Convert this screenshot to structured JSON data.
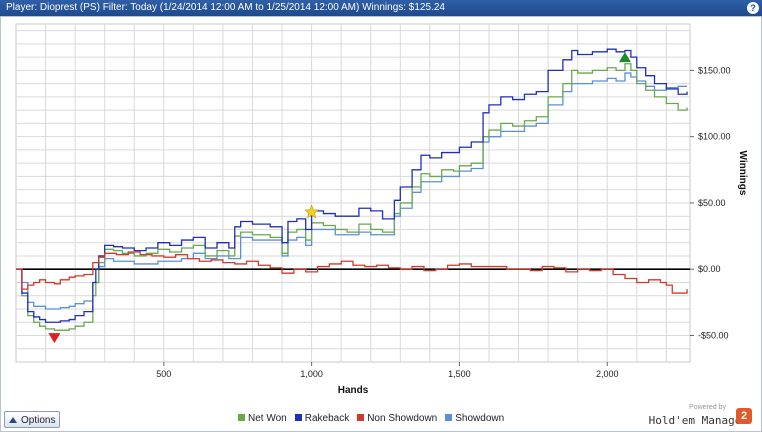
{
  "header": {
    "title": "Player: Dioprest (PS) Filter: Today (1/24/2014 12:00 AM to 1/25/2014 12:00 AM) Winnings: $125.24",
    "help_label": "?"
  },
  "controls": {
    "options_label": "Options"
  },
  "brand": {
    "powered_by": "Powered by",
    "name": "Hold'em Manager",
    "logo_text": "2"
  },
  "colors": {
    "net_won": "#6aa84f",
    "rakeback": "#1f2fb8",
    "non_showdown": "#d03a2a",
    "showdown": "#5b8fd8",
    "grid": "#d9d9d9",
    "zero_line": "#000000",
    "titlebar": "#1e4a8e"
  },
  "chart_data": {
    "type": "line",
    "xlabel": "Hands",
    "ylabel": "Winnings",
    "xlim": [
      0,
      2280
    ],
    "ylim": [
      -70,
      185
    ],
    "x_ticks": [
      500,
      1000,
      1500,
      2000
    ],
    "x_tick_labels": [
      "500",
      "1,000",
      "1,500",
      "2,000"
    ],
    "y_ticks": [
      -50,
      0,
      50,
      100,
      150
    ],
    "y_tick_labels": [
      "-$50.00",
      "$0.00",
      "$50.00",
      "$100.00",
      "$150.00"
    ],
    "grid": true,
    "legend_position": "bottom",
    "series": [
      {
        "name": "Net Won",
        "color": "#6aa84f",
        "x": [
          0,
          20,
          40,
          60,
          80,
          100,
          130,
          150,
          180,
          200,
          230,
          260,
          270,
          280,
          300,
          330,
          360,
          400,
          440,
          480,
          520,
          560,
          600,
          640,
          680,
          720,
          740,
          760,
          800,
          860,
          900,
          920,
          950,
          980,
          1000,
          1040,
          1080,
          1120,
          1160,
          1200,
          1240,
          1280,
          1300,
          1340,
          1370,
          1400,
          1440,
          1480,
          1500,
          1540,
          1580,
          1600,
          1640,
          1680,
          1720,
          1760,
          1800,
          1850,
          1880,
          1900,
          1950,
          2000,
          2030,
          2060,
          2080,
          2100,
          2130,
          2160,
          2200,
          2240,
          2270
        ],
        "values": [
          0,
          -20,
          -35,
          -40,
          -43,
          -45,
          -46,
          -46,
          -45,
          -43,
          -40,
          -20,
          -10,
          5,
          15,
          14,
          12,
          10,
          12,
          15,
          13,
          16,
          18,
          10,
          14,
          10,
          25,
          28,
          26,
          24,
          12,
          28,
          30,
          22,
          35,
          33,
          30,
          28,
          34,
          30,
          28,
          42,
          50,
          62,
          72,
          70,
          75,
          74,
          78,
          80,
          100,
          105,
          110,
          108,
          112,
          115,
          130,
          140,
          150,
          148,
          150,
          152,
          150,
          155,
          150,
          140,
          135,
          130,
          125,
          120,
          122
        ]
      },
      {
        "name": "Rakeback",
        "color": "#1f2fb8",
        "x": [
          0,
          20,
          40,
          60,
          80,
          100,
          130,
          150,
          180,
          200,
          230,
          260,
          270,
          280,
          300,
          330,
          360,
          400,
          440,
          480,
          520,
          560,
          600,
          640,
          680,
          720,
          740,
          760,
          800,
          860,
          900,
          920,
          950,
          980,
          1000,
          1040,
          1080,
          1120,
          1160,
          1200,
          1240,
          1280,
          1300,
          1340,
          1370,
          1400,
          1440,
          1480,
          1500,
          1540,
          1580,
          1600,
          1640,
          1680,
          1720,
          1760,
          1800,
          1850,
          1880,
          1900,
          1950,
          2000,
          2030,
          2060,
          2080,
          2100,
          2130,
          2160,
          2200,
          2240,
          2270
        ],
        "values": [
          0,
          -18,
          -32,
          -36,
          -38,
          -40,
          -40,
          -39,
          -38,
          -35,
          -32,
          -10,
          0,
          10,
          18,
          17,
          16,
          14,
          16,
          20,
          18,
          22,
          24,
          16,
          20,
          16,
          32,
          36,
          34,
          32,
          20,
          36,
          38,
          30,
          44,
          42,
          40,
          40,
          46,
          44,
          38,
          52,
          62,
          75,
          86,
          84,
          88,
          88,
          92,
          96,
          118,
          124,
          130,
          128,
          132,
          134,
          150,
          158,
          165,
          162,
          164,
          166,
          164,
          165,
          160,
          152,
          146,
          140,
          136,
          132,
          134
        ]
      },
      {
        "name": "Non Showdown",
        "color": "#d03a2a",
        "x": [
          0,
          20,
          40,
          60,
          80,
          100,
          130,
          150,
          180,
          200,
          230,
          260,
          280,
          300,
          340,
          380,
          420,
          460,
          500,
          540,
          580,
          620,
          660,
          700,
          740,
          780,
          820,
          860,
          900,
          940,
          980,
          1020,
          1060,
          1100,
          1140,
          1180,
          1220,
          1260,
          1300,
          1340,
          1380,
          1420,
          1460,
          1500,
          1540,
          1580,
          1620,
          1660,
          1700,
          1740,
          1780,
          1820,
          1860,
          1900,
          1940,
          1980,
          2020,
          2060,
          2100,
          2140,
          2180,
          2200,
          2220,
          2240,
          2270
        ],
        "values": [
          0,
          -15,
          -12,
          -10,
          -8,
          -10,
          -11,
          -8,
          -6,
          -5,
          -4,
          5,
          9,
          12,
          11,
          13,
          11,
          10,
          9,
          11,
          8,
          6,
          7,
          5,
          4,
          6,
          3,
          1,
          -3,
          0,
          -2,
          2,
          4,
          6,
          3,
          2,
          3,
          1,
          0,
          2,
          -1,
          0,
          3,
          4,
          2,
          2,
          2,
          0,
          0,
          -1,
          2,
          1,
          -2,
          0,
          -1,
          0,
          -4,
          -7,
          -10,
          -8,
          -10,
          -12,
          -18,
          -18,
          -15
        ]
      },
      {
        "name": "Showdown",
        "color": "#5b8fd8",
        "x": [
          0,
          20,
          40,
          60,
          80,
          100,
          130,
          150,
          180,
          200,
          230,
          260,
          280,
          300,
          330,
          360,
          400,
          440,
          480,
          520,
          560,
          600,
          640,
          680,
          720,
          760,
          800,
          860,
          900,
          920,
          950,
          980,
          1000,
          1040,
          1080,
          1120,
          1160,
          1200,
          1240,
          1280,
          1300,
          1340,
          1370,
          1400,
          1440,
          1480,
          1500,
          1540,
          1580,
          1600,
          1640,
          1680,
          1720,
          1760,
          1800,
          1850,
          1880,
          1900,
          1950,
          2000,
          2030,
          2060,
          2080,
          2100,
          2130,
          2160,
          2200,
          2240,
          2270
        ],
        "values": [
          0,
          -10,
          -25,
          -28,
          -28,
          -30,
          -30,
          -29,
          -28,
          -26,
          -24,
          -10,
          2,
          8,
          6,
          6,
          4,
          4,
          6,
          6,
          8,
          12,
          8,
          10,
          8,
          24,
          22,
          22,
          10,
          22,
          24,
          18,
          30,
          30,
          26,
          26,
          28,
          26,
          26,
          40,
          46,
          58,
          66,
          66,
          70,
          70,
          74,
          76,
          96,
          100,
          104,
          104,
          108,
          110,
          124,
          134,
          140,
          140,
          142,
          144,
          142,
          148,
          145,
          142,
          138,
          135,
          137,
          138,
          138
        ]
      }
    ],
    "markers": [
      {
        "kind": "min",
        "shape": "triangle-down",
        "color": "#e02020",
        "x": 130,
        "y": -52
      },
      {
        "kind": "max",
        "shape": "triangle-up",
        "color": "#1e8a2a",
        "x": 2060,
        "y": 160
      },
      {
        "kind": "star",
        "shape": "star",
        "color": "#f2d21a",
        "x": 1000,
        "y": 43
      }
    ]
  }
}
